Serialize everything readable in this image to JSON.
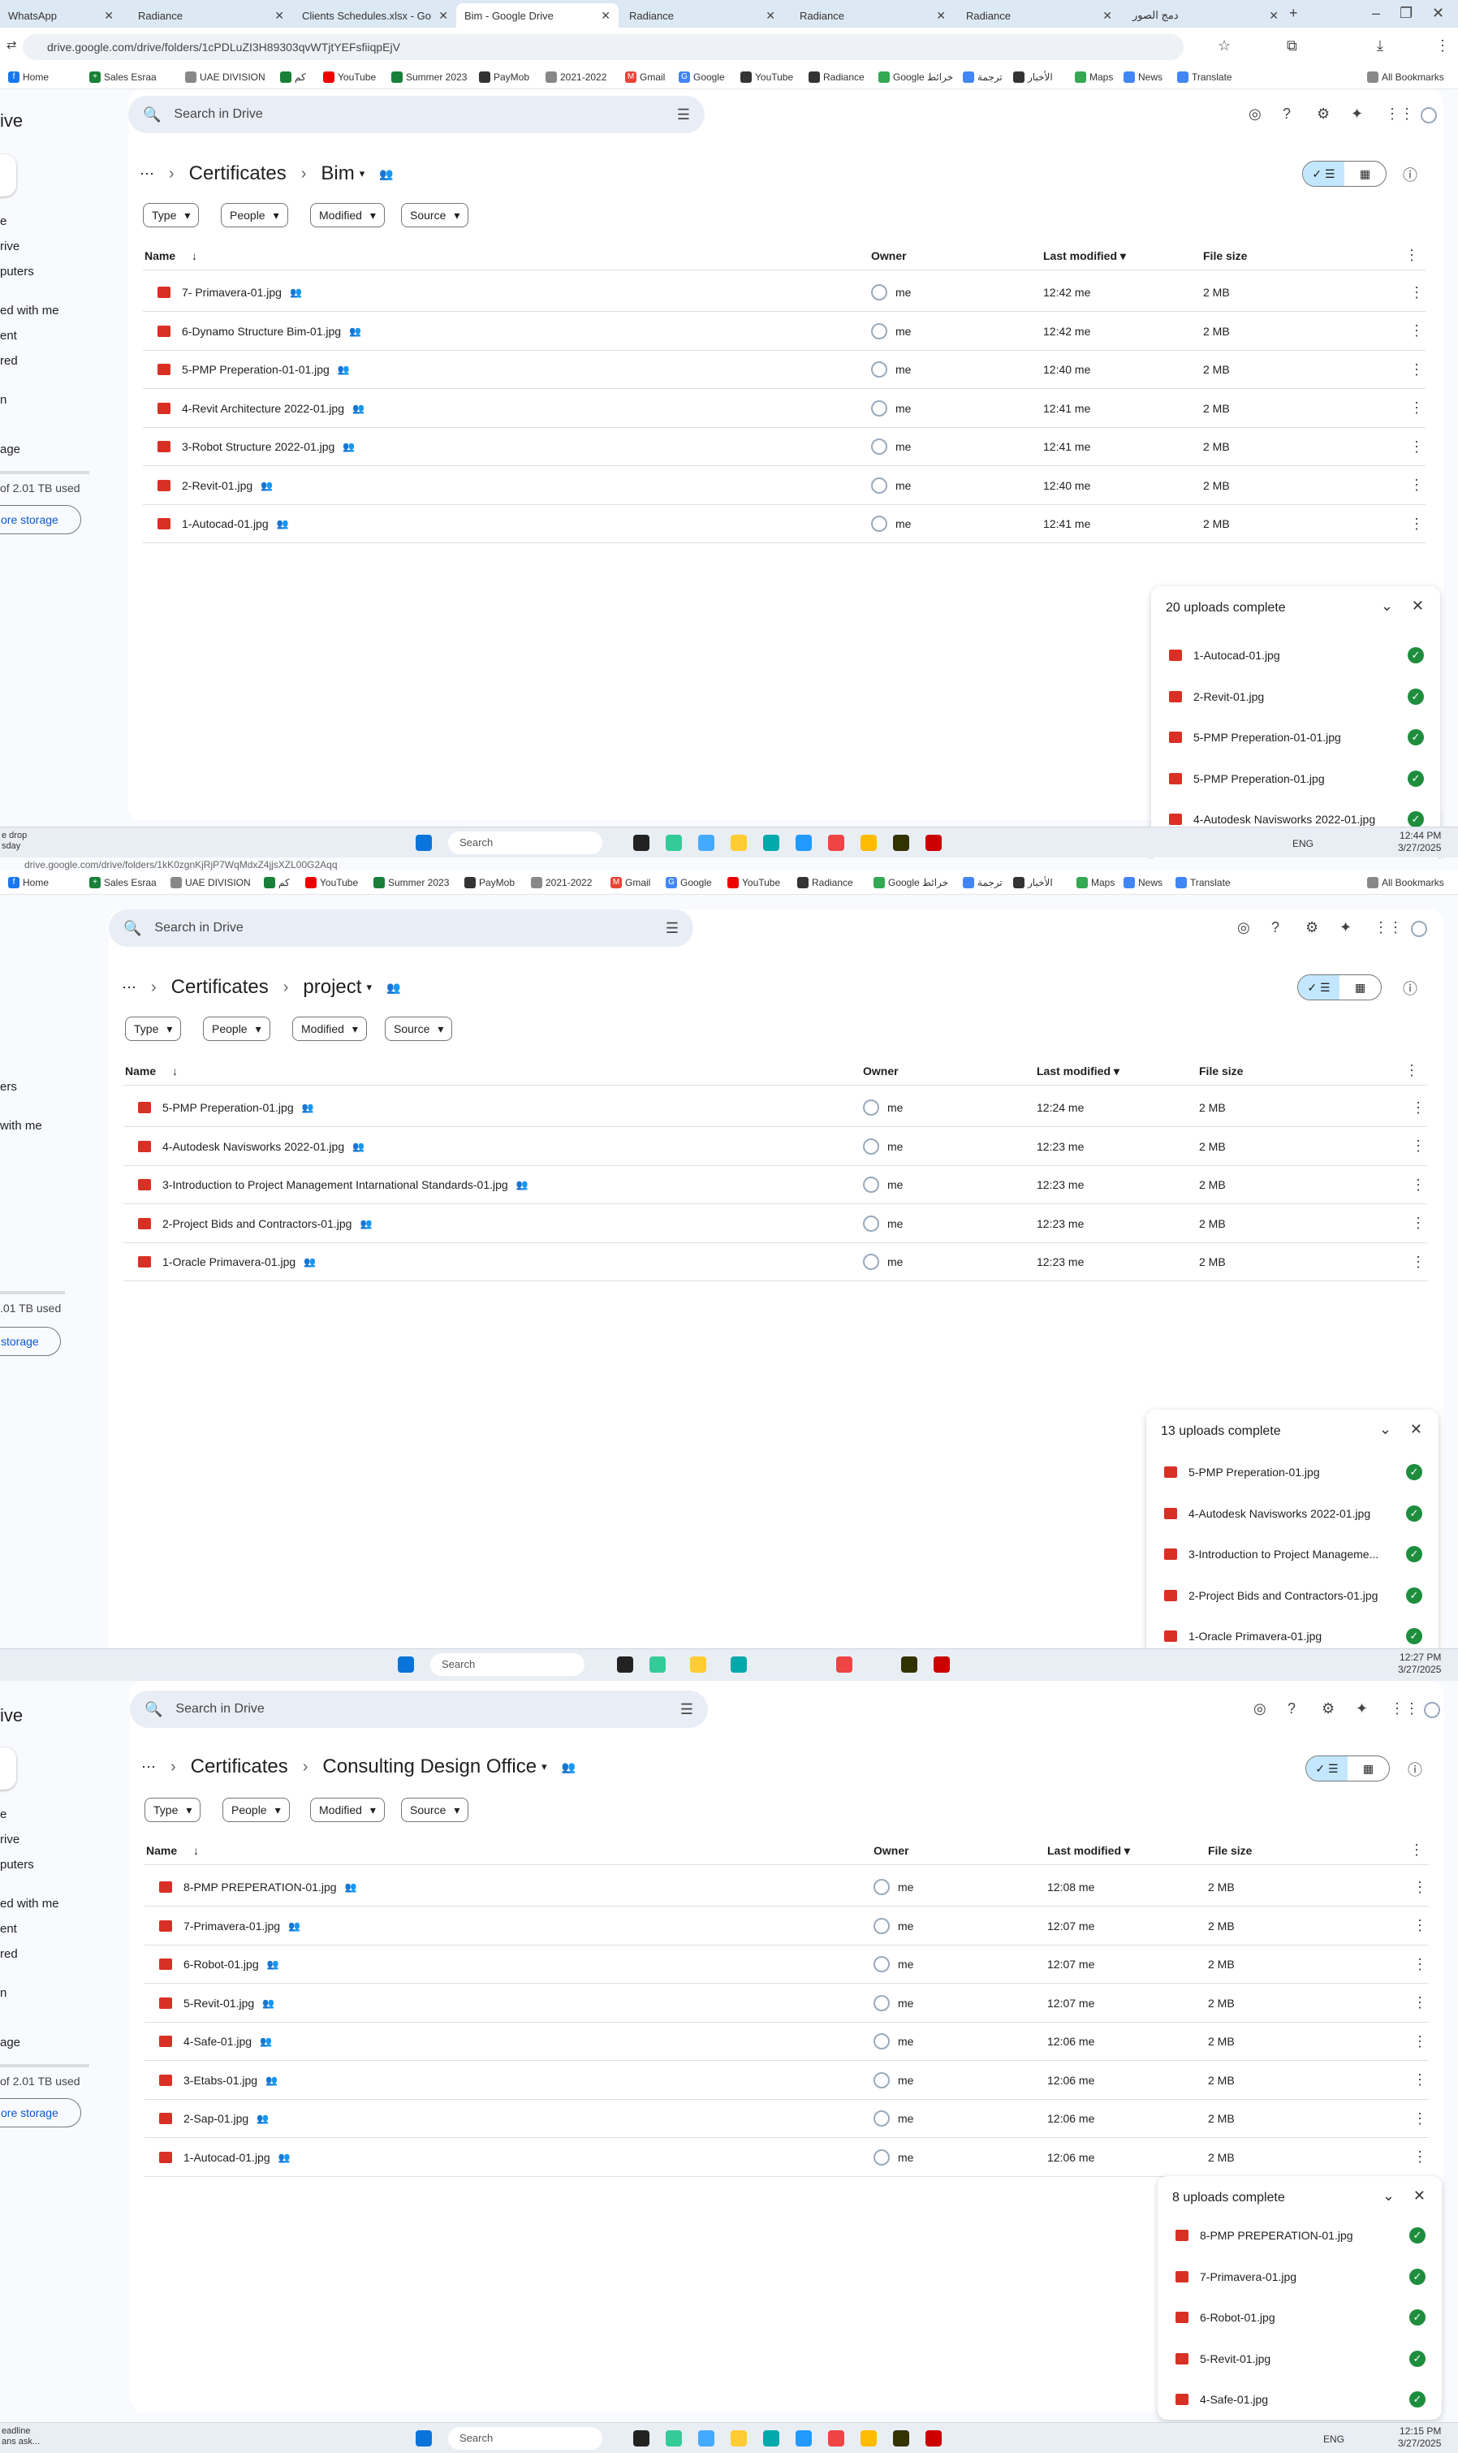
{
  "tabs": [
    {
      "label": "WhatsApp"
    },
    {
      "label": "Radiance"
    },
    {
      "label": "Clients Schedules.xlsx - Go"
    },
    {
      "label": "Bim - Google Drive"
    },
    {
      "label": "Radiance"
    },
    {
      "label": "Radiance"
    },
    {
      "label": "Radiance"
    },
    {
      "label": "دمج الصور"
    }
  ],
  "url": "drive.google.com/drive/folders/1cPDLuZI3H89303qvWTjtYEFsfiiqpEjV",
  "url2": "drive.google.com/drive/folders/1kK0zgnKjRjP7WqMdxZ4jjsXZL00G2Aqq",
  "bookmarks": [
    "Home",
    "Sales Esraa",
    "UAE DIVISION",
    "كم",
    "YouTube",
    "Summer 2023",
    "PayMob",
    "2021-2022",
    "Gmail",
    "Google",
    "YouTube",
    "Radiance",
    "Google خرائط",
    "ترجمة",
    "الأخبار",
    "Maps",
    "News",
    "Translate",
    "All Bookmarks"
  ],
  "drive": {
    "brand": "ive",
    "search_placeholder": "Search in Drive",
    "sidebar_items": [
      "e",
      "rive",
      "puters",
      "ed with me",
      "ent",
      "red",
      "n",
      "age"
    ],
    "sidebar_items_2": [
      "ers",
      "with me"
    ],
    "storage_text": "of 2.01 TB used",
    "storage_text_2": ".01 TB used",
    "storage_button": "ore storage",
    "storage_button_2": "storage",
    "filters": [
      "Type",
      "People",
      "Modified",
      "Source"
    ],
    "columns": {
      "name": "Name",
      "owner": "Owner",
      "modified": "Last modified",
      "size": "File size"
    },
    "owner": "me",
    "size": "2 MB"
  },
  "screen1": {
    "root": "Certificates",
    "folder": "Bim",
    "files": [
      {
        "name": "7- Primavera-01.jpg",
        "time": "12:42 me"
      },
      {
        "name": "6-Dynamo Structure Bim-01.jpg",
        "time": "12:42 me"
      },
      {
        "name": "5-PMP Preperation-01-01.jpg",
        "time": "12:40 me"
      },
      {
        "name": "4-Revit  Architecture 2022-01.jpg",
        "time": "12:41 me"
      },
      {
        "name": "3-Robot Structure 2022-01.jpg",
        "time": "12:41 me"
      },
      {
        "name": "2-Revit-01.jpg",
        "time": "12:40 me"
      },
      {
        "name": "1-Autocad-01.jpg",
        "time": "12:41 me"
      }
    ],
    "uploads_title": "20 uploads complete",
    "uploads": [
      "1-Autocad-01.jpg",
      "2-Revit-01.jpg",
      "5-PMP Preperation-01-01.jpg",
      "5-PMP Preperation-01.jpg",
      "4-Autodesk Navisworks 2022-01.jpg"
    ],
    "clock_time": "12:44 PM",
    "clock_date": "3/27/2025",
    "left_status_1": "e drop",
    "left_status_2": "sday"
  },
  "screen2": {
    "root": "Certificates",
    "folder": "project",
    "files": [
      {
        "name": "5-PMP Preperation-01.jpg",
        "time": "12:24 me"
      },
      {
        "name": "4-Autodesk Navisworks 2022-01.jpg",
        "time": "12:23 me"
      },
      {
        "name": "3-Introduction  to Project  Management Intarnational  Standards-01.jpg",
        "time": "12:23 me"
      },
      {
        "name": "2-Project Bids and Contractors-01.jpg",
        "time": "12:23 me"
      },
      {
        "name": "1-Oracle Primavera-01.jpg",
        "time": "12:23 me"
      }
    ],
    "uploads_title": "13 uploads complete",
    "uploads": [
      "5-PMP Preperation-01.jpg",
      "4-Autodesk Navisworks 2022-01.jpg",
      "3-Introduction to Project Manageme...",
      "2-Project Bids and Contractors-01.jpg",
      "1-Oracle Primavera-01.jpg"
    ],
    "clock_time": "12:27 PM",
    "clock_date": "3/27/2025"
  },
  "screen3": {
    "root": "Certificates",
    "folder": "Consulting Design Office",
    "files": [
      {
        "name": "8-PMP PREPERATION-01.jpg",
        "time": "12:08 me"
      },
      {
        "name": "7-Primavera-01.jpg",
        "time": "12:07 me"
      },
      {
        "name": "6-Robot-01.jpg",
        "time": "12:07 me"
      },
      {
        "name": "5-Revit-01.jpg",
        "time": "12:07 me"
      },
      {
        "name": "4-Safe-01.jpg",
        "time": "12:06 me"
      },
      {
        "name": "3-Etabs-01.jpg",
        "time": "12:06 me"
      },
      {
        "name": "2-Sap-01.jpg",
        "time": "12:06 me"
      },
      {
        "name": "1-Autocad-01.jpg",
        "time": "12:06 me"
      }
    ],
    "uploads_title": "8 uploads complete",
    "uploads": [
      "8-PMP PREPERATION-01.jpg",
      "7-Primavera-01.jpg",
      "6-Robot-01.jpg",
      "5-Revit-01.jpg",
      "4-Safe-01.jpg"
    ],
    "clock_time": "12:15 PM",
    "clock_date": "3/27/2025",
    "left_status_1": "eadline",
    "left_status_2": "ans ask..."
  },
  "taskbar": {
    "search": "Search",
    "lang": "ENG"
  }
}
